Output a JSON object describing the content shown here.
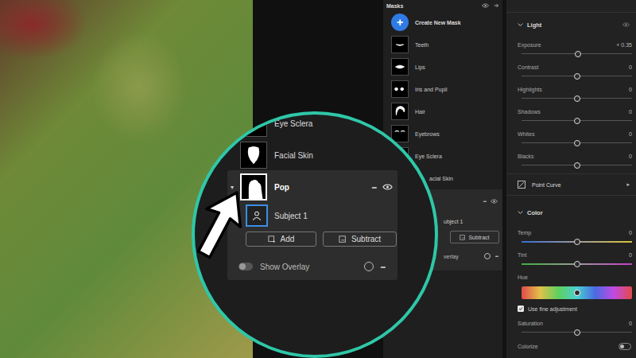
{
  "masks_panel": {
    "title": "Masks",
    "create_button": {
      "icon": "+",
      "label": "Create New Mask"
    },
    "items": [
      {
        "label": "Teeth"
      },
      {
        "label": "Lips"
      },
      {
        "label": "Iris and Pupil"
      },
      {
        "label": "Hair"
      },
      {
        "label": "Eyebrows"
      },
      {
        "label": "Eye Sclera"
      },
      {
        "label": "acial Skin"
      }
    ],
    "group": {
      "menu": "•••",
      "visible": true,
      "child_label": "ubject 1",
      "button": "Subtract",
      "overlay_label": "verlay",
      "overlay_menu": "•••"
    }
  },
  "zoom": {
    "items": [
      {
        "label": "Eye Sclera"
      },
      {
        "label": "Facial Skin"
      }
    ],
    "group": {
      "caret": "▾",
      "label": "Pop",
      "selected": true,
      "menu": "•••",
      "visible": true,
      "child": {
        "label": "Subject 1",
        "selected": true
      },
      "buttons": [
        "Add",
        "Subtract"
      ],
      "overlay": {
        "label": "Show Overlay",
        "on": false
      },
      "overlay_menu": "•••"
    }
  },
  "adjust_panel": {
    "sections": [
      {
        "title": "Light",
        "expanded": true,
        "eye": true,
        "rows": [
          {
            "kind": "slider",
            "label": "Exposure",
            "reading": "+ 0.35",
            "level": 0.51
          },
          {
            "kind": "slider",
            "label": "Contrast",
            "reading": "0",
            "level": 0.5
          },
          {
            "kind": "slider",
            "label": "Highlights",
            "reading": "0",
            "level": 0.5
          },
          {
            "kind": "slider",
            "label": "Shadows",
            "reading": "0",
            "level": 0.5
          },
          {
            "kind": "slider",
            "label": "Whites",
            "reading": "0",
            "level": 0.5
          },
          {
            "kind": "slider",
            "label": "Blacks",
            "reading": "0",
            "level": 0.5
          },
          {
            "kind": "curve",
            "label": "Point Curve",
            "arrow": "▸"
          }
        ]
      },
      {
        "title": "Color",
        "expanded": true,
        "eye": false,
        "rows": [
          {
            "kind": "temp",
            "label": "Temp",
            "reading": "0",
            "level": 0.5
          },
          {
            "kind": "tint",
            "label": "Tint",
            "reading": "0",
            "level": 0.5
          },
          {
            "kind": "hue",
            "label": "Hue",
            "level": 0.5
          },
          {
            "kind": "checkbox",
            "label": "Use fine adjustment",
            "checked": true
          },
          {
            "kind": "slider",
            "label": "Saturation",
            "reading": "0",
            "level": 0.5
          },
          {
            "kind": "toggle",
            "label": "Colorize",
            "on": false
          }
        ]
      }
    ]
  }
}
